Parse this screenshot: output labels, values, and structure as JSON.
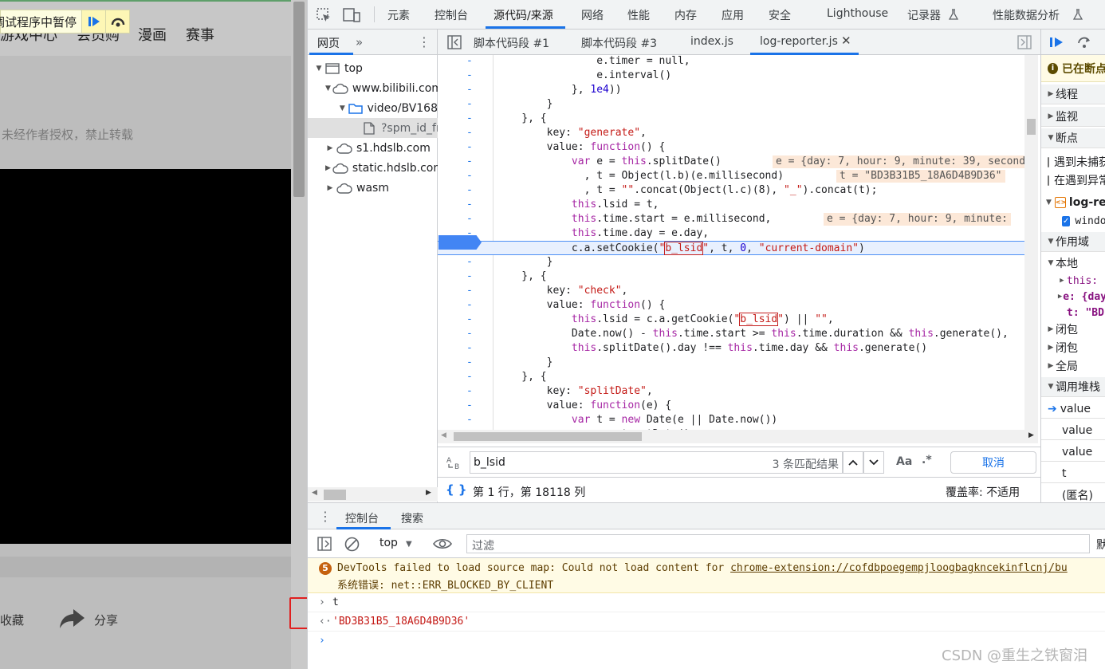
{
  "webpage": {
    "nav_items": [
      "游戏中心",
      "会员购",
      "漫画",
      "赛事"
    ],
    "pause_banner": "已在调试程序中暂停",
    "notice": "未经作者授权，禁止转载",
    "favorite_label": "收藏",
    "share_label": "分享"
  },
  "devtools": {
    "main_tabs": [
      "元素",
      "控制台",
      "源代码/来源",
      "网络",
      "性能",
      "内存",
      "应用",
      "安全",
      "Lighthouse",
      "记录器",
      "性能数据分析"
    ],
    "active_tab": "源代码/来源",
    "navigator": {
      "tab_label": "网页",
      "tree": [
        {
          "label": "top",
          "icon": "frame-icon",
          "expanded": true
        },
        {
          "label": "www.bilibili.com",
          "icon": "cloud-icon",
          "expanded": true
        },
        {
          "label": "video/BV168",
          "icon": "folder-icon",
          "expanded": true
        },
        {
          "label": "?spm_id_from",
          "icon": "file-icon",
          "selected": true
        },
        {
          "label": "s1.hdslb.com",
          "icon": "cloud-icon",
          "expanded": false
        },
        {
          "label": "static.hdslb.com",
          "icon": "cloud-icon",
          "expanded": false
        },
        {
          "label": "wasm",
          "icon": "cloud-icon",
          "expanded": false
        }
      ]
    },
    "editor_tabs": [
      "脚本代码段 #1",
      "脚本代码段 #3",
      "index.js",
      "log-reporter.js"
    ],
    "active_editor_tab": "log-reporter.js",
    "search": {
      "query": "b_lsid",
      "result_count": "3 条匹配结果",
      "match_case": "Aa",
      "regex": ".*",
      "cancel_label": "取消"
    },
    "status": {
      "position": "第 1 行，第 18118 列",
      "coverage": "覆盖率: 不适用"
    },
    "debugger": {
      "paused_label": "已在断点",
      "sections": [
        "线程",
        "监视",
        "断点",
        "作用域",
        "调用堆栈"
      ],
      "breakpoint_options": [
        "遇到未捕获的异常时暂停",
        "在遇到异常时暂停"
      ],
      "breakpoint_file": "log-reporter.js",
      "breakpoint_code": "window",
      "scope_local": "本地",
      "scope_vars": [
        "this:",
        "e: {day",
        "t: \"BD"
      ],
      "closures": [
        "闭包",
        "闭包",
        "全局"
      ],
      "call_stack": [
        "value",
        "value",
        "value",
        "t",
        "(匿名)"
      ]
    },
    "drawer": {
      "tabs": [
        "控制台",
        "搜索"
      ],
      "context": "top",
      "filter_placeholder": "过滤",
      "default_levels": "默认"
    },
    "console": {
      "warning_count": "5",
      "warning_line1_prefix": "DevTools failed to load source map: Could not load content for ",
      "warning_link": "chrome-extension://cofdbpoegempjloogbagkncekinflcnj/bu",
      "warning_line2": "系统错误: net::ERR_BLOCKED_BY_CLIENT",
      "input": "t",
      "output": "'BD3B31B5_18A6D4B9D36'"
    }
  },
  "code": {
    "lines": [
      "                e.timer = null,",
      "                e.interval()",
      "            }, 1e4))",
      "        }",
      "    }, {",
      "        key: \"generate\",",
      "        value: function() {",
      "            var e = this.splitDate()",
      "              , t = Object(l.b)(e.millisecond)",
      "              , t = \"\".concat(Object(l.c)(8), \"_\").concat(t);",
      "            this.lsid = t,",
      "            this.time.start = e.millisecond,",
      "            this.time.day = e.day,",
      "            c.a.setCookie(\"b_lsid\", t, 0, \"current-domain\")",
      "        }",
      "    }, {",
      "        key: \"check\",",
      "        value: function() {",
      "            this.lsid = c.a.getCookie(\"b_lsid\") || \"\",",
      "            Date.now() - this.time.start >= this.time.duration && this.generate(),",
      "            this.splitDate().day !== this.time.day && this.generate()",
      "        }",
      "    }, {",
      "        key: \"splitDate\",",
      "        value: function(e) {",
      "            var t = new Date(e || Date.now())",
      "              , n = t.getDate()"
    ],
    "inline_values": {
      "line8": "e = {day: 7, hour: 9, minute: 39, second",
      "line9": "t = \"BD3B31B5_18A6D4B9D36\"",
      "line12": "e = {day: 7, hour: 9, minute:"
    }
  },
  "watermark": "CSDN @重生之铁窗泪",
  "colors": {
    "accent": "#1a73e8",
    "warning_bg": "#fffbe5",
    "annotation_red": "#e02020"
  }
}
